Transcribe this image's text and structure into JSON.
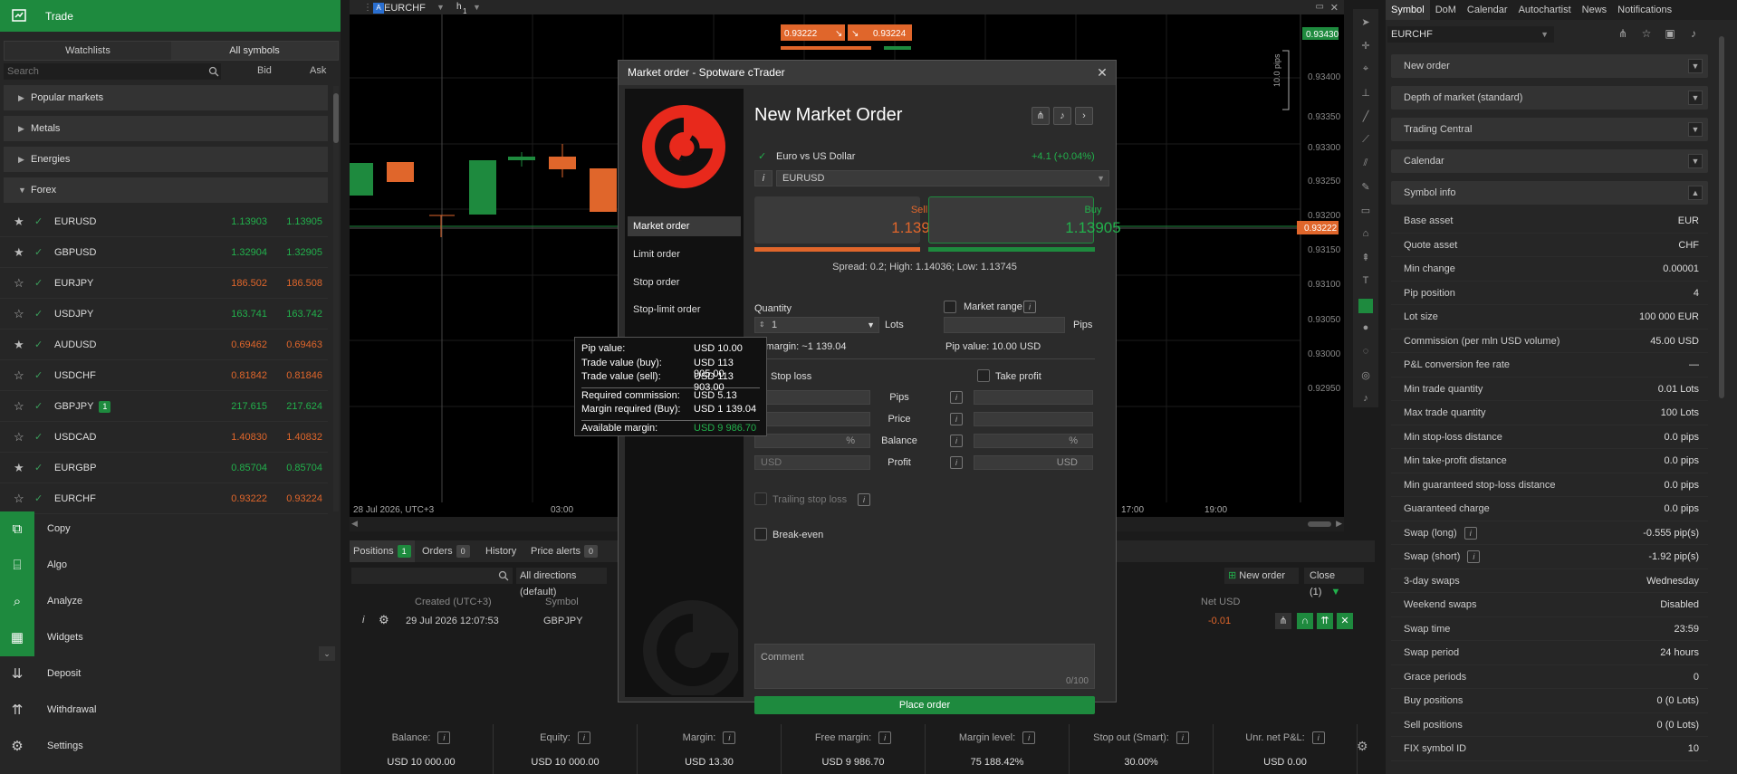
{
  "left": {
    "header": "Trade",
    "tabs": [
      "Watchlists",
      "All symbols"
    ],
    "search_placeholder": "Search",
    "bid_label": "Bid",
    "ask_label": "Ask",
    "categories": [
      "Popular markets",
      "Metals",
      "Energies",
      "Forex"
    ],
    "symbols": [
      {
        "star": "★",
        "name": "EURUSD",
        "bid": "1.13903",
        "ask": "1.13905",
        "dir": "up"
      },
      {
        "star": "★",
        "name": "GBPUSD",
        "bid": "1.32904",
        "ask": "1.32905",
        "dir": "up"
      },
      {
        "star": "☆",
        "name": "EURJPY",
        "bid": "186.502",
        "ask": "186.508",
        "dir": "dn"
      },
      {
        "star": "☆",
        "name": "USDJPY",
        "bid": "163.741",
        "ask": "163.742",
        "dir": "up"
      },
      {
        "star": "★",
        "name": "AUDUSD",
        "bid": "0.69462",
        "ask": "0.69463",
        "dir": "dn"
      },
      {
        "star": "☆",
        "name": "USDCHF",
        "bid": "0.81842",
        "ask": "0.81846",
        "dir": "dn"
      },
      {
        "star": "☆",
        "name": "GBPJPY",
        "bid": "217.615",
        "ask": "217.624",
        "dir": "up",
        "badge": "1"
      },
      {
        "star": "☆",
        "name": "USDCAD",
        "bid": "1.40830",
        "ask": "1.40832",
        "dir": "dn"
      },
      {
        "star": "★",
        "name": "EURGBP",
        "bid": "0.85704",
        "ask": "0.85704",
        "dir": "up"
      },
      {
        "star": "☆",
        "name": "EURCHF",
        "bid": "0.93222",
        "ask": "0.93224",
        "dir": "dn"
      }
    ],
    "nav": [
      {
        "label": "Copy",
        "icon": "copy-icon"
      },
      {
        "label": "Algo",
        "icon": "algo-icon"
      },
      {
        "label": "Analyze",
        "icon": "analyze-icon"
      },
      {
        "label": "Widgets",
        "icon": "widgets-icon"
      },
      {
        "label": "Deposit",
        "icon": "deposit-icon"
      },
      {
        "label": "Withdrawal",
        "icon": "withdrawal-icon"
      },
      {
        "label": "Settings",
        "icon": "gear-icon"
      }
    ]
  },
  "chart": {
    "symbol": "EURCHF",
    "timeframe": "h",
    "timeframe_sub": "1",
    "sell_quote": "0.93222",
    "buy_quote": "0.93224",
    "pips_label": "10.0 pips",
    "price_labels": [
      "0.93400",
      "0.93350",
      "0.93300",
      "0.93250",
      "0.93200",
      "0.93150",
      "0.93100",
      "0.93050",
      "0.93000",
      "0.92950"
    ],
    "current_price": "0.93222",
    "top_price": "0.93430",
    "time_labels": [
      "28 Jul 2026, UTC+3",
      "03:00",
      "17:00",
      "19:00"
    ]
  },
  "bottom": {
    "tabs": [
      {
        "label": "Positions",
        "count": "1"
      },
      {
        "label": "Orders",
        "count": "0"
      },
      {
        "label": "History"
      },
      {
        "label": "Price alerts",
        "count": "0"
      }
    ],
    "filter": "All directions (default)",
    "new_order": "New order",
    "close_btn": "Close (1)",
    "headers": [
      "Created (UTC+3)",
      "Symbol",
      "Net USD"
    ],
    "row": {
      "created": "29 Jul 2026 12:07:53",
      "symbol": "GBPJPY",
      "net": "-0.01"
    },
    "stats": [
      {
        "label": "Balance:",
        "value": "USD 10 000.00"
      },
      {
        "label": "Equity:",
        "value": "USD 10 000.00"
      },
      {
        "label": "Margin:",
        "value": "USD 13.30"
      },
      {
        "label": "Free margin:",
        "value": "USD 9 986.70"
      },
      {
        "label": "Margin level:",
        "value": "75 188.42%"
      },
      {
        "label": "Stop out (Smart):",
        "value": "30.00%"
      },
      {
        "label": "Unr. net P&L:",
        "value": "USD 0.00"
      }
    ]
  },
  "right": {
    "tabs": [
      "Symbol",
      "DoM",
      "Calendar",
      "Autochartist",
      "News",
      "Notifications"
    ],
    "symbol_select": "EURCHF",
    "sections": [
      "New order",
      "Depth of market (standard)",
      "Trading Central",
      "Calendar",
      "Symbol info"
    ],
    "info": [
      {
        "k": "Base asset",
        "v": "EUR"
      },
      {
        "k": "Quote asset",
        "v": "CHF"
      },
      {
        "k": "Min change",
        "v": "0.00001"
      },
      {
        "k": "Pip position",
        "v": "4"
      },
      {
        "k": "Lot size",
        "v": "100 000 EUR"
      },
      {
        "k": "Commission (per mln USD volume)",
        "v": "45.00 USD"
      },
      {
        "k": "P&L conversion fee rate",
        "v": "—"
      },
      {
        "k": "Min trade quantity",
        "v": "0.01 Lots"
      },
      {
        "k": "Max trade quantity",
        "v": "100 Lots"
      },
      {
        "k": "Min stop-loss distance",
        "v": "0.0 pips"
      },
      {
        "k": "Min take-profit distance",
        "v": "0.0 pips"
      },
      {
        "k": "Min guaranteed stop-loss distance",
        "v": "0.0 pips"
      },
      {
        "k": "Guaranteed charge",
        "v": "0.0 pips"
      },
      {
        "k": "Swap (long)",
        "v": "-0.555 pip(s)",
        "info": true
      },
      {
        "k": "Swap (short)",
        "v": "-1.92 pip(s)",
        "info": true
      },
      {
        "k": "3-day swaps",
        "v": "Wednesday"
      },
      {
        "k": "Weekend swaps",
        "v": "Disabled"
      },
      {
        "k": "Swap time",
        "v": "23:59"
      },
      {
        "k": "Swap period",
        "v": "24 hours"
      },
      {
        "k": "Grace periods",
        "v": "0"
      },
      {
        "k": "Buy positions",
        "v": "0  (0 Lots)"
      },
      {
        "k": "Sell positions",
        "v": "0  (0 Lots)"
      },
      {
        "k": "FIX symbol ID",
        "v": "10"
      }
    ]
  },
  "dialog": {
    "title": "Market order - Spotware cTrader",
    "order_types": [
      "Market order",
      "Limit order",
      "Stop order",
      "Stop-limit order"
    ],
    "heading": "New Market Order",
    "symbol_desc": "Euro vs US Dollar",
    "change": "+4.1 (+0.04%)",
    "symbol": "EURUSD",
    "sell_label": "Sell",
    "sell_price": "1.13903",
    "buy_label": "Buy",
    "buy_price": "1.13905",
    "spread": "Spread: 0.2; High: 1.14036; Low: 1.13745",
    "quantity_label": "Quantity",
    "quantity": "1",
    "lots": "Lots",
    "market_range": "Market range",
    "pips": "Pips",
    "margin_text": "y margin: ~1 139.04",
    "pip_value": "Pip value: 10.00 USD",
    "stop_loss": "Stop loss",
    "take_profit": "Take profit",
    "row_labels": [
      "Pips",
      "Price",
      "Balance",
      "Profit"
    ],
    "pct": "%",
    "usd_placeholder": "USD",
    "usd": "USD",
    "trailing": "Trailing stop loss",
    "break_even": "Break-even",
    "comment_placeholder": "Comment",
    "comment_count": "0/100",
    "place": "Place order"
  },
  "tooltip": [
    {
      "k": "Pip value:",
      "v": "USD 10.00"
    },
    {
      "k": "Trade value (buy):",
      "v": "USD 113 905.00"
    },
    {
      "k": "Trade value (sell):",
      "v": "USD 113 903.00"
    },
    {
      "k": "Required commission:",
      "v": "USD 5.13"
    },
    {
      "k": "Margin required (Buy):",
      "v": "USD 1 139.04"
    },
    {
      "k": "Available margin:",
      "v": "USD 9 986.70"
    }
  ],
  "colors": {
    "accent": "#1e8a3e",
    "sell": "#e0662b",
    "buy": "#22b14c"
  }
}
